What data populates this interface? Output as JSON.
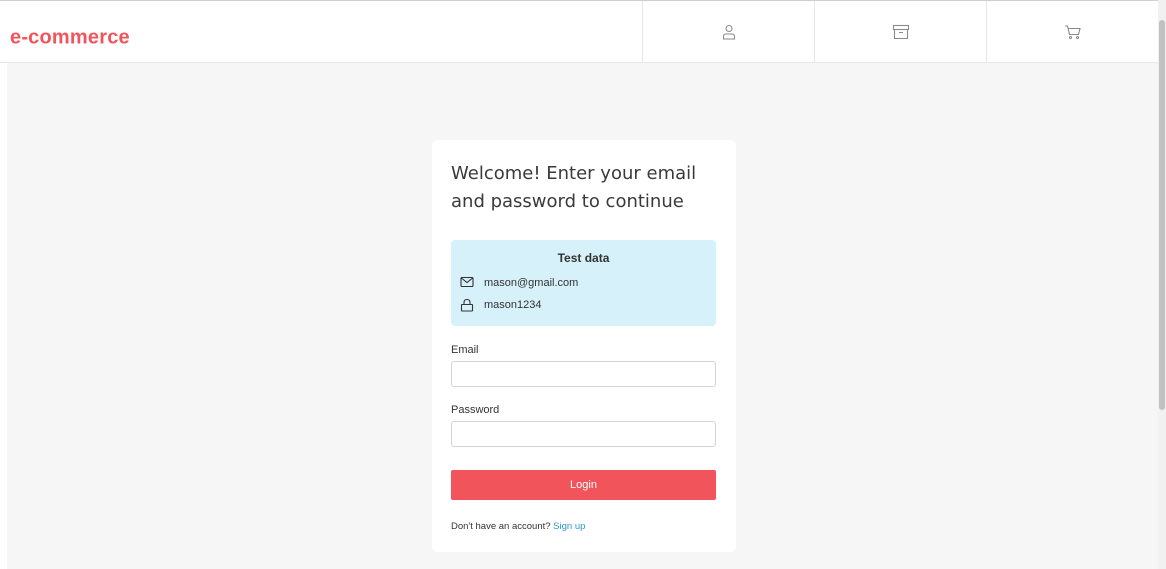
{
  "header": {
    "brand": "e-commerce",
    "nav": [
      {
        "icon": "user-icon"
      },
      {
        "icon": "archive-icon"
      },
      {
        "icon": "cart-icon"
      }
    ]
  },
  "login": {
    "title": "Welcome! Enter your email and password to continue",
    "test_data": {
      "title": "Test data",
      "email": "mason@gmail.com",
      "password": "mason1234"
    },
    "email_label": "Email",
    "email_value": "",
    "password_label": "Password",
    "password_value": "",
    "login_button": "Login",
    "signup_prompt": "Don't have an account?",
    "signup_link": "Sign up"
  },
  "colors": {
    "brand": "#f2545b",
    "test_box_bg": "#d6f1fa",
    "link": "#2e95d3",
    "page_bg": "#f6f6f6"
  }
}
